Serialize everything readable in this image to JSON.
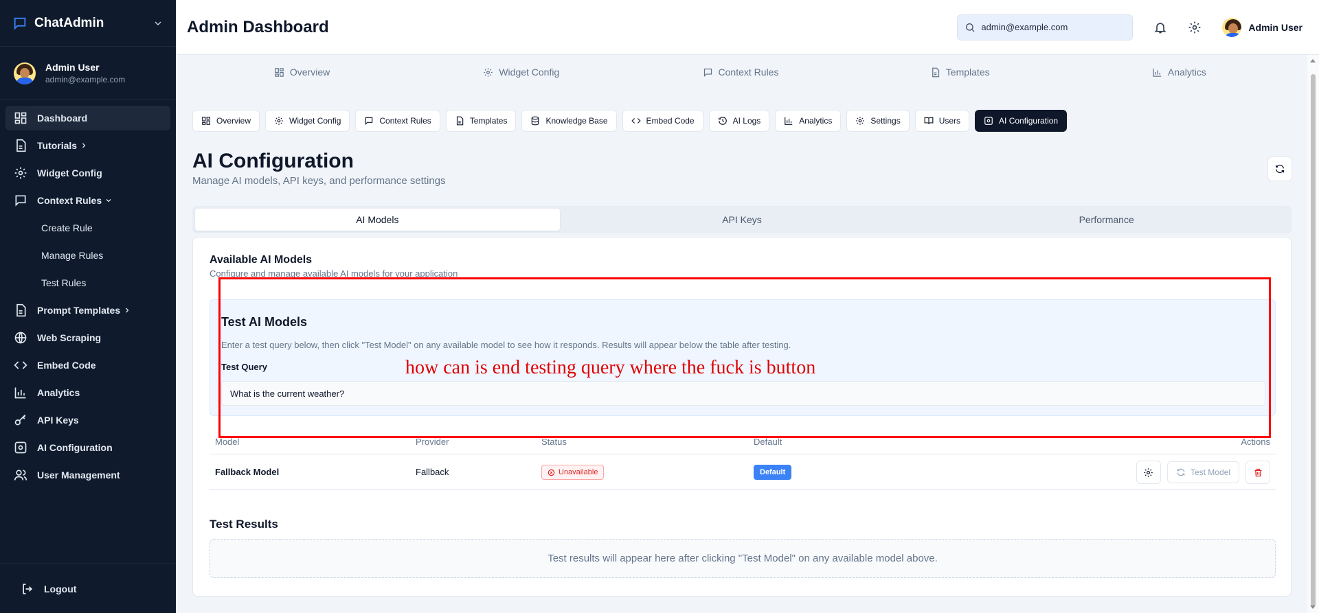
{
  "app": {
    "name": "ChatAdmin"
  },
  "sidebar": {
    "user": {
      "name": "Admin User",
      "email": "admin@example.com"
    },
    "items": [
      {
        "label": "Dashboard",
        "icon": "dashboard-icon"
      },
      {
        "label": "Tutorials",
        "icon": "document-icon"
      },
      {
        "label": "Widget Config",
        "icon": "gear-icon"
      },
      {
        "label": "Context Rules",
        "icon": "message-icon"
      },
      {
        "label": "Create Rule"
      },
      {
        "label": "Manage Rules"
      },
      {
        "label": "Test Rules"
      },
      {
        "label": "Prompt Templates",
        "icon": "document-icon"
      },
      {
        "label": "Web Scraping",
        "icon": "globe-icon"
      },
      {
        "label": "Embed Code",
        "icon": "code-icon"
      },
      {
        "label": "Analytics",
        "icon": "chart-icon"
      },
      {
        "label": "API Keys",
        "icon": "key-icon"
      },
      {
        "label": "AI Configuration",
        "icon": "gear-icon"
      },
      {
        "label": "User Management",
        "icon": "users-icon"
      }
    ],
    "logout": "Logout"
  },
  "header": {
    "title": "Admin Dashboard",
    "search_value": "admin@example.com",
    "user_name": "Admin User"
  },
  "top_tabs": [
    "Overview",
    "Widget Config",
    "Context Rules",
    "Templates",
    "Analytics"
  ],
  "pills": [
    "Overview",
    "Widget Config",
    "Context Rules",
    "Templates",
    "Knowledge Base",
    "Embed Code",
    "AI Logs",
    "Analytics",
    "Settings",
    "Users",
    "AI Configuration"
  ],
  "page": {
    "title": "AI Configuration",
    "subtitle": "Manage AI models, API keys, and performance settings"
  },
  "segments": [
    "AI Models",
    "API Keys",
    "Performance"
  ],
  "models_card": {
    "title": "Available AI Models",
    "description": "Configure and manage available AI models for your application",
    "test": {
      "title": "Test AI Models",
      "description": "Enter a test query below, then click \"Test Model\" on any available model to see how it responds. Results will appear below the table after testing.",
      "label": "Test Query",
      "value": "What is the current weather?"
    },
    "table": {
      "headers": [
        "Model",
        "Provider",
        "Status",
        "Default",
        "Actions"
      ],
      "rows": [
        {
          "model": "Fallback Model",
          "provider": "Fallback",
          "status": "Unavailable",
          "default": "Default",
          "test_label": "Test Model"
        }
      ]
    },
    "results_title": "Test Results",
    "results_empty": "Test results will appear here after clicking \"Test Model\" on any available model above."
  },
  "annotation": {
    "text": "how can is end testing query where the fuck is button",
    "color": "#ff0000"
  },
  "colors": {
    "sidebar_bg": "#0f1b2d",
    "primary": "#0f172a",
    "accent_blue": "#3b82f6",
    "danger": "#dc2626"
  }
}
